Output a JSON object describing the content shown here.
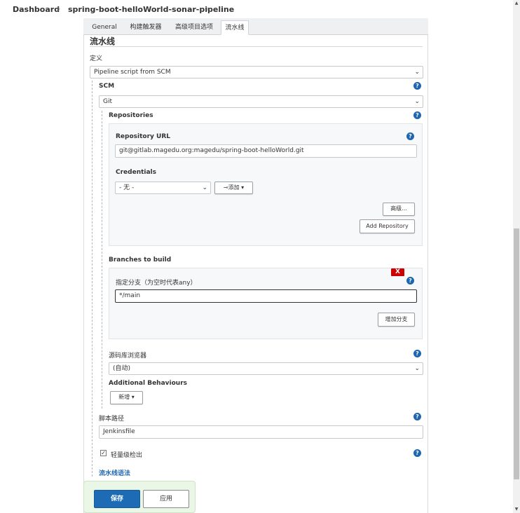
{
  "breadcrumb": {
    "items": [
      "Dashboard",
      "spring-boot-helloWorld-sonar-pipeline"
    ]
  },
  "tabs": [
    {
      "label": "General",
      "active": false
    },
    {
      "label": "构建触发器",
      "active": false
    },
    {
      "label": "高级项目选项",
      "active": false
    },
    {
      "label": "流水线",
      "active": true
    }
  ],
  "pipeline": {
    "section_title": "流水线",
    "definition_label": "定义",
    "definition_value": "Pipeline script from SCM",
    "scm_label": "SCM",
    "scm_value": "Git",
    "repositories_label": "Repositories",
    "repo_url_label": "Repository URL",
    "repo_url_value": "git@gitlab.magedu.org:magedu/spring-boot-helloWorld.git",
    "credentials_label": "Credentials",
    "credentials_value": "- 无 -",
    "add_credential_label": "添加",
    "advanced_label": "高级...",
    "add_repository_label": "Add Repository",
    "branches_label": "Branches to build",
    "branch_delete_label": "X",
    "branch_specifier_label": "指定分支（为空时代表any）",
    "branch_specifier_value": "*/main",
    "add_branch_label": "增加分支",
    "repo_browser_label": "源码库浏览器",
    "repo_browser_value": "(自动)",
    "additional_behaviours_label": "Additional Behaviours",
    "add_behaviour_label": "新增",
    "script_path_label": "脚本路径",
    "script_path_value": "Jenkinsfile",
    "lightweight_checkout_label": "轻量级检出",
    "lightweight_checkout_checked": true,
    "syntax_link_label": "流水线语法"
  },
  "actions": {
    "save_label": "保存",
    "apply_label": "应用"
  },
  "icons": {
    "help": "question-circle-icon",
    "dropdown": "chevron-down-icon",
    "key": "key-icon",
    "check": "checkmark-icon"
  },
  "colors": {
    "primary": "#1d6bb5",
    "help": "#1f66b1",
    "danger": "#cc0000",
    "savebar": "#eaf6e6"
  }
}
